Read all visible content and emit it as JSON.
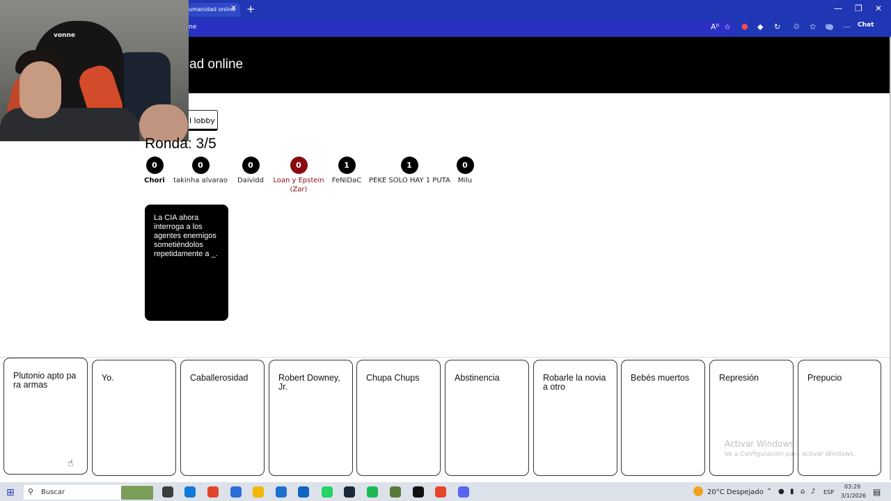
{
  "browser": {
    "tab_title": "umanidad online",
    "tab_close": "✕",
    "new_tab": "+",
    "address_text": "ne",
    "chat_label": "Chat",
    "window_controls": [
      "—",
      "❐",
      "✕"
    ],
    "nav_icons": [
      "A⁰",
      "☆",
      "⬢",
      "◆",
      "↻",
      "♲",
      "✩",
      "⧉",
      "●",
      "⋯"
    ]
  },
  "webcam": {
    "logo_text": "vonne"
  },
  "page": {
    "title": "ad online",
    "lobby_button": "l lobby",
    "round_label": "Ronda: 3/5"
  },
  "players": [
    {
      "name": "Chori",
      "score": "0",
      "style": "bold"
    },
    {
      "name": "takinha alvarao",
      "score": "0",
      "style": "normal"
    },
    {
      "name": "Daividd",
      "score": "0",
      "style": "normal"
    },
    {
      "name": "Loan y Epstein (Zar)",
      "score": "0",
      "style": "red"
    },
    {
      "name": "FeNiDaC",
      "score": "1",
      "style": "normal"
    },
    {
      "name": "PEKE SOLO HAY 1 PUTA",
      "score": "1",
      "style": "normal"
    },
    {
      "name": "Milu",
      "score": "0",
      "style": "normal"
    }
  ],
  "black_card": {
    "text": "La CIA ahora interroga a los agentes enemigos sometiéndolos repetidamente a _."
  },
  "hand": [
    "Plutonio apto para armas",
    "Yo.",
    "Caballerosidad",
    "Robert Downey, Jr.",
    "Chupa Chups",
    "Abstinencia",
    "Robarle la novia a otro",
    "Bebés muertos",
    "Represión",
    "Prepucio"
  ],
  "watermark": {
    "line1": "Activar Windows",
    "line2": "Ve a Configuración para activar Windows."
  },
  "taskbar": {
    "start_icon": "⊞",
    "search_placeholder": "Buscar",
    "weather": "20°C  Despejado",
    "language": "ESP",
    "time": "03:29",
    "date": "3/1/2026",
    "notifications_icon": "▤",
    "icon_colors": [
      "#3c3c3c",
      "#0f7ad8",
      "#e0452b",
      "#2b6ed8",
      "#f2b705",
      "#1f6fd1",
      "#0f65c2",
      "#25d366",
      "#1b2838",
      "#1db954",
      "#5a7a3a",
      "#111111",
      "#e8452b",
      "#5865f2"
    ]
  },
  "colors": {
    "browser_chrome": "#1f37b4",
    "page_header": "#000000",
    "active_player": "#8b0b12"
  }
}
